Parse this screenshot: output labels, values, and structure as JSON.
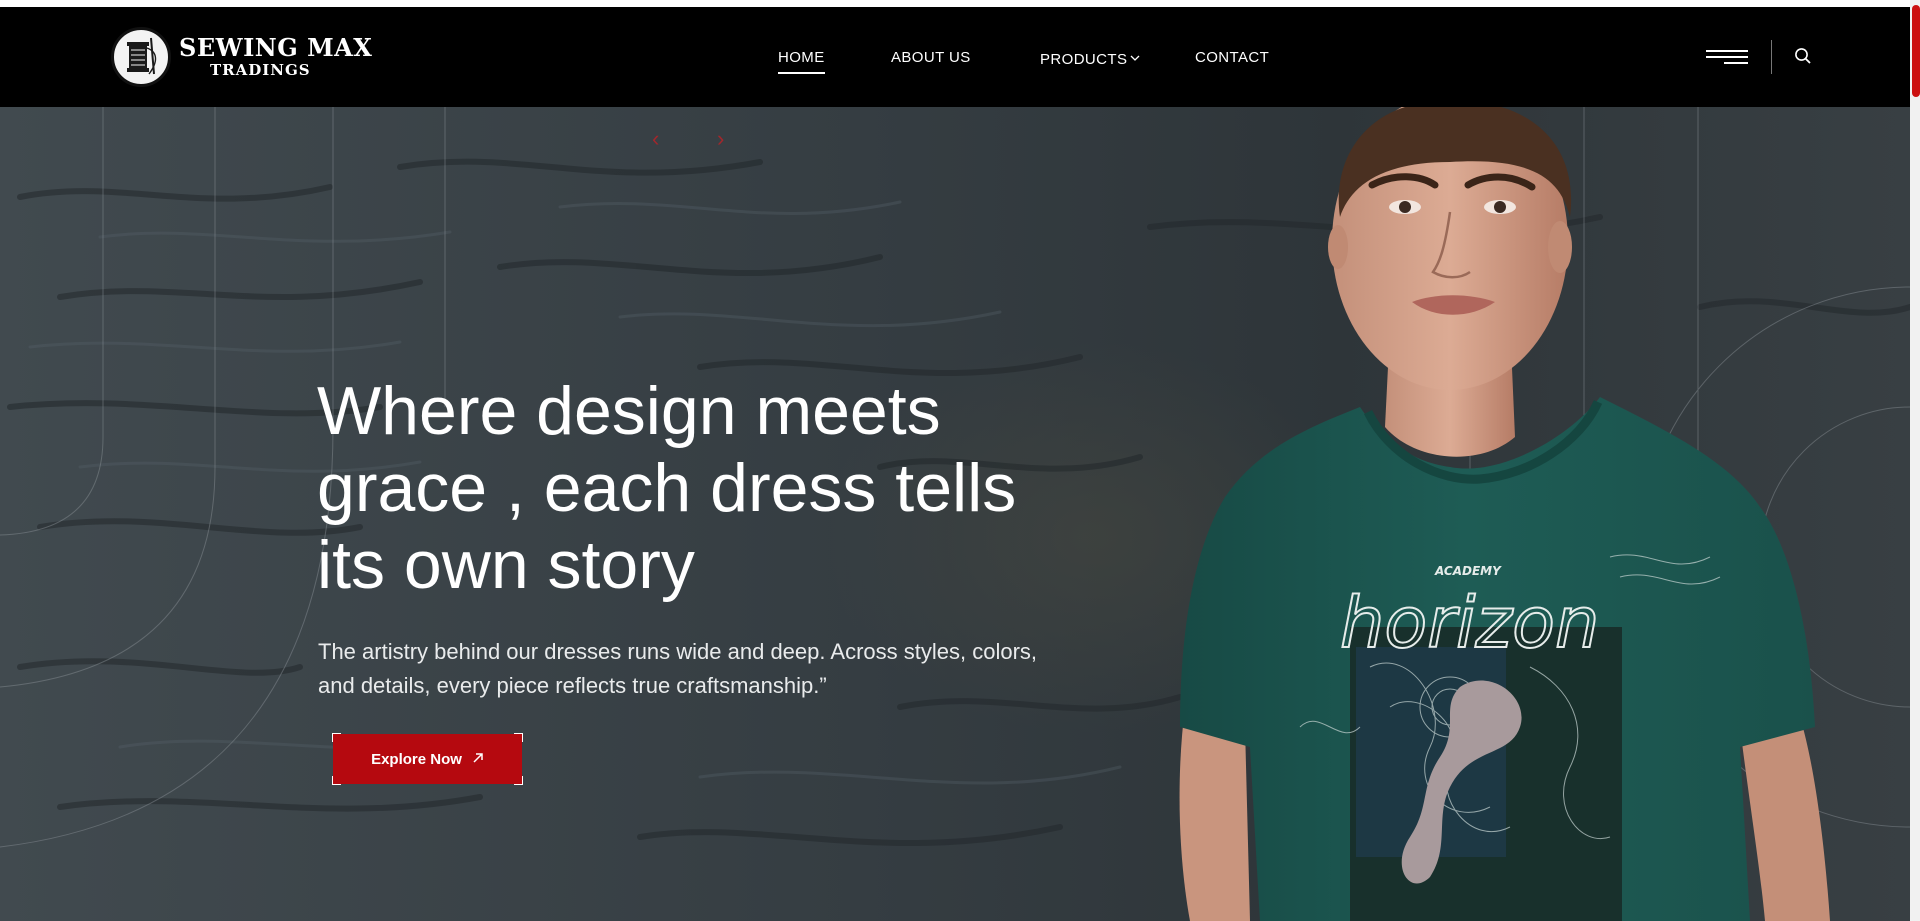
{
  "brand": {
    "name_line1": "SEWING MAX",
    "name_line2": "TRADINGS",
    "emblem_icon": "sewing-thread-spool-logo"
  },
  "nav": {
    "items": [
      {
        "label": "HOME",
        "active": true
      },
      {
        "label": "ABOUT US",
        "active": false
      },
      {
        "label": "PRODUCTS",
        "active": false,
        "has_dropdown": true
      },
      {
        "label": "CONTACT",
        "active": false
      }
    ],
    "dropdown_glyph": "⌵",
    "menu_icon": "hamburger-menu-icon",
    "search_icon": "search-icon"
  },
  "hero": {
    "headline": "Where design meets grace , each dress tells its own story",
    "description": "The artistry behind our dresses runs wide and deep. Across styles, colors, and details, every piece reflects true craftsmanship.”",
    "cta_label": "Explore Now",
    "cta_icon": "arrow-up-right-icon",
    "prev_glyph": "‹",
    "next_glyph": "›",
    "shirt_print": {
      "small_text": "ACADEMY",
      "big_text": "horizon"
    }
  },
  "colors": {
    "header_bg": "#000000",
    "accent_red": "#b5090f",
    "shirt_green": "#1e5c55",
    "hero_bg": "#353d42"
  }
}
